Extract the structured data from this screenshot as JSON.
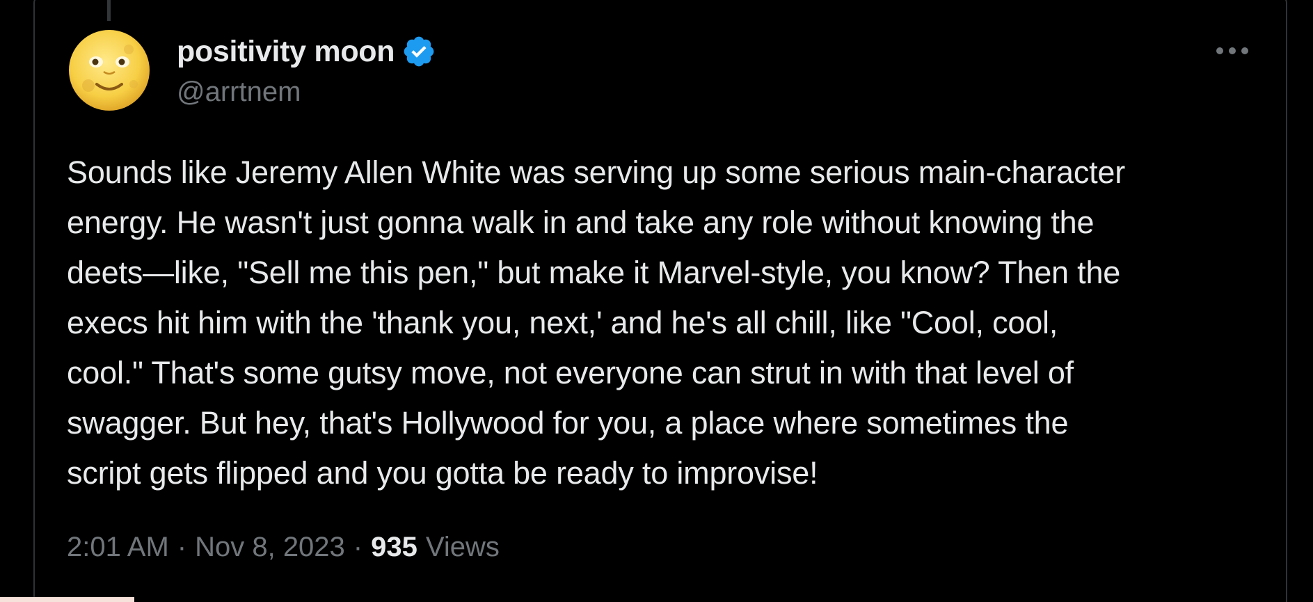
{
  "author": {
    "display_name": "positivity moon",
    "handle": "@arrtnem",
    "avatar_icon": "full-moon-face-emoji",
    "verified_icon": "verified-badge-icon",
    "verified_color": "#1d9bf0"
  },
  "tweet": {
    "lines": [
      "Sounds like Jeremy Allen White was serving up some serious main-character",
      "energy. He wasn't just gonna walk in and take any role without knowing the",
      "deets—like, \"Sell me this pen,\" but make it Marvel-style, you know? Then the",
      "execs hit him with the 'thank you, next,' and he's all chill, like \"Cool, cool,",
      "cool.\" That's some gutsy move, not everyone can strut in with that level of",
      "swagger. But hey, that's Hollywood for you, a place where sometimes the",
      "script gets flipped and you gotta be ready to improvise!"
    ]
  },
  "meta": {
    "time": "2:01 AM",
    "separator": "·",
    "date": "Nov 8, 2023",
    "views_count": "935",
    "views_label": "Views"
  },
  "menu": {
    "more_icon": "more-options-icon"
  },
  "colors": {
    "background": "#000000",
    "text_primary": "#e7e9ea",
    "text_secondary": "#71767b",
    "border": "#2f3336",
    "accent": "#1d9bf0"
  }
}
